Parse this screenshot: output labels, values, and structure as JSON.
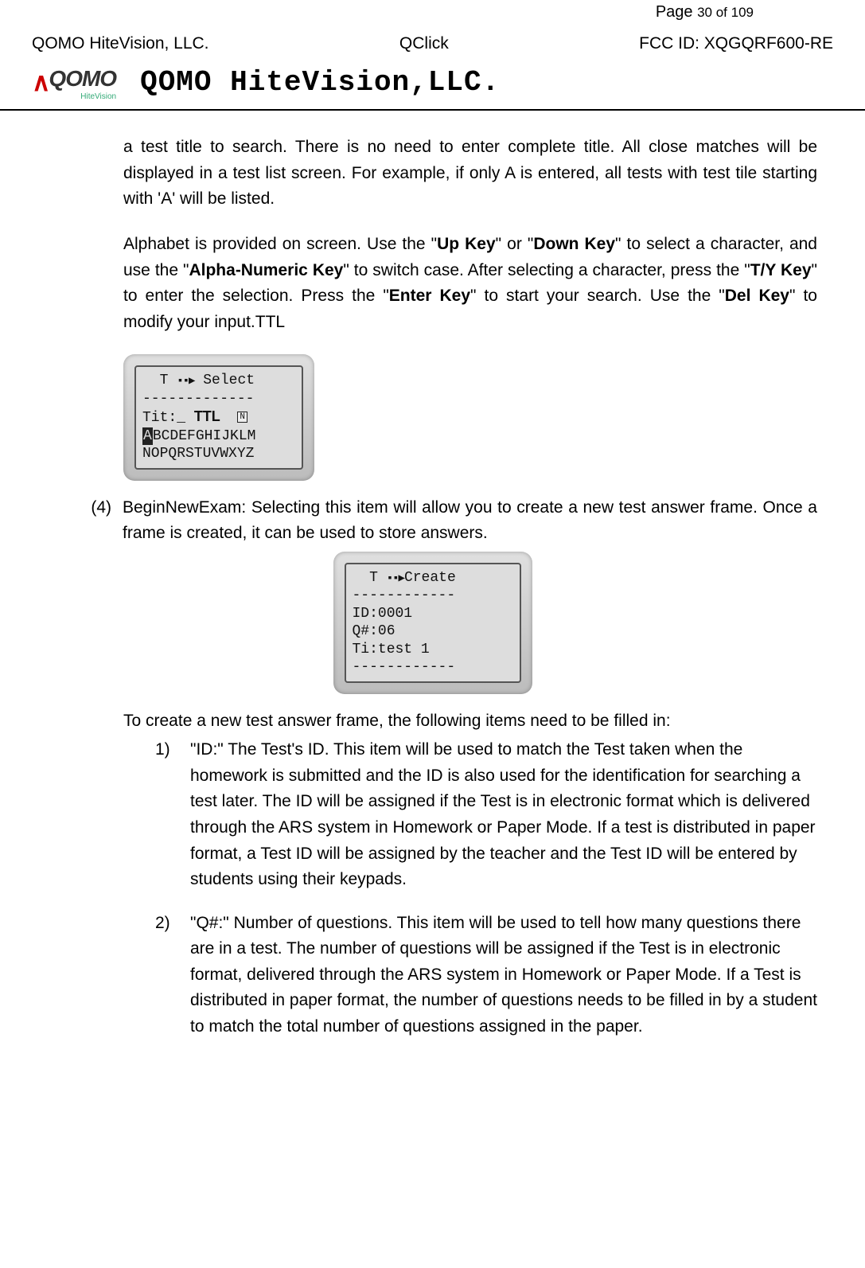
{
  "header": {
    "left": "QOMO HiteVision, LLC.",
    "center": "QClick",
    "page_label_prefix": "Page ",
    "page_current": "30",
    "page_of": " of ",
    "page_total": "109",
    "fcc": "FCC ID: XQGQRF600-RE"
  },
  "logo": {
    "text": "QOMO",
    "sub": "HiteVision",
    "brand": "QOMO HiteVision,LLC."
  },
  "para1": "a test title to search. There is no need to enter complete title. All close matches will be displayed in a test list screen. For example, if only A is entered, all tests with test tile starting with 'A' will be listed.",
  "para2_parts": {
    "t1": "Alphabet is provided on screen. Use the \"",
    "b1": "Up Key",
    "t2": "\" or \"",
    "b2": "Down Key",
    "t3": "\" to select a character, and use the \"",
    "b3": "Alpha-Numeric Key",
    "t4": "\" to switch case. After selecting a character, press the \"",
    "b4": "T/Y Key",
    "t5": "\" to enter the selection. Press the \"",
    "b5": "Enter Key",
    "t6": "\" to start your search. Use the \"",
    "b6": "Del Key",
    "t7": "\" to modify your input.TTL"
  },
  "device1": {
    "line1_a": "T ",
    "line1_arrow": "▪▪▶",
    "line1_b": " Select",
    "dashes": "-------------",
    "tit_label": "Tit:_ ",
    "ttl": "TTL",
    "n_badge": "N",
    "alpha1_inv": "A",
    "alpha1_rest": "BCDEFGHIJKLM",
    "alpha2": "NOPQRSTUVWXYZ"
  },
  "item4": {
    "num": "(4)",
    "text": "BeginNewExam: Selecting this item will allow you to create a new test answer frame. Once a frame is created, it can be used to store answers."
  },
  "device2": {
    "line1_a": "T ",
    "line1_arrow": "▪▪▶",
    "line1_b": "Create",
    "dashes": "------------",
    "id_line": "ID:0001",
    "q_line": "Q#:06",
    "ti_line": "Ti:test 1",
    "dashes2": "------------"
  },
  "para3": "To create a new test answer frame, the following items need to be filled in:",
  "sub1": {
    "num": "1)",
    "text": "\"ID:\" The Test's ID. This item will be used to match the Test taken when the homework is submitted and the ID is also used for the identification for searching a test later. The ID will be assigned if the Test is in electronic format which is delivered through the ARS system in Homework or Paper Mode. If a test is distributed in paper format, a Test ID will be assigned by the teacher and the Test ID will be entered by students using their keypads."
  },
  "sub2": {
    "num": "2)",
    "text": " \"Q#:\" Number of questions. This item will be used to tell how many questions there are in a test. The number of questions will be assigned if the Test is in electronic format, delivered through the ARS system in Homework or Paper Mode. If a Test is distributed in paper format, the number of questions needs to be filled in by a student to match the total number of questions assigned in the paper."
  }
}
